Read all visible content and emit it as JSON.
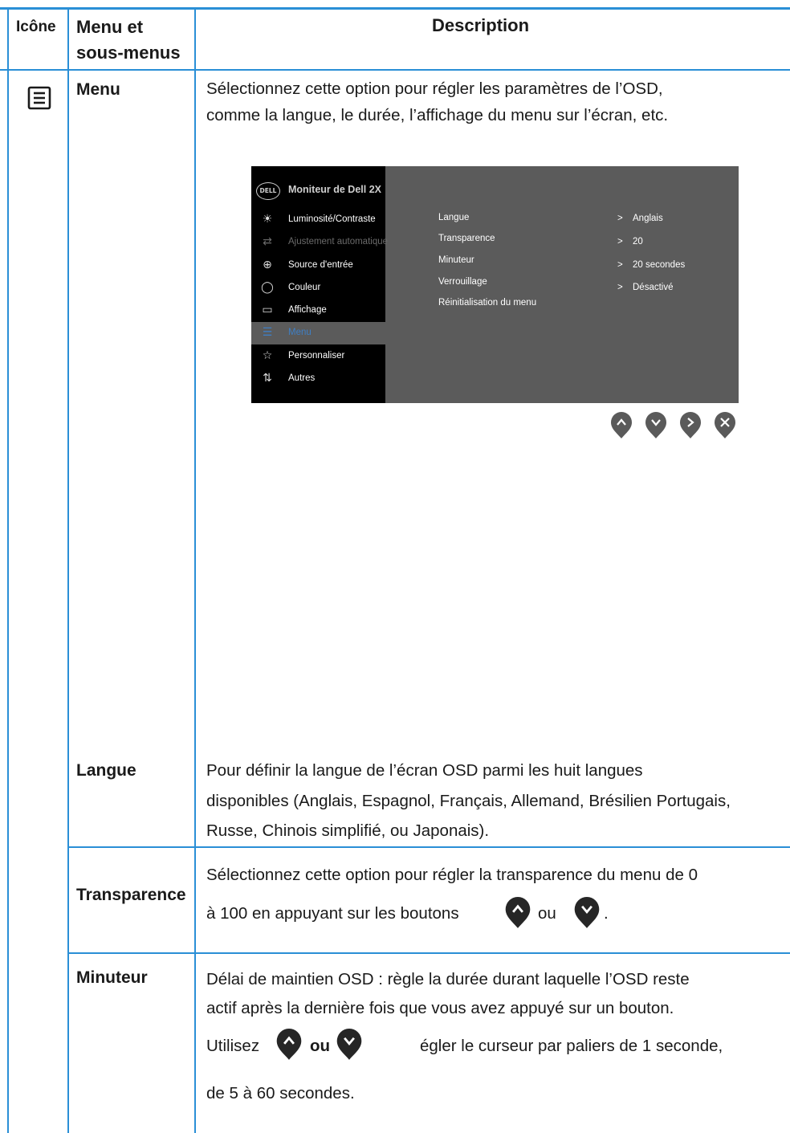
{
  "header": {
    "col_icon": "Icône",
    "col_menu_line1": "Menu et",
    "col_menu_line2": "sous-menus",
    "col_desc": "Description"
  },
  "rows": {
    "menu": {
      "icon": "menu-icon",
      "term": "Menu",
      "desc_line1": "Sélectionnez cette option pour régler les paramètres de l’OSD,",
      "desc_line2": "comme la langue, le durée, l’affichage du menu sur l’écran, etc."
    },
    "langue": {
      "term": "Langue",
      "desc_line1": "Pour définir la langue de l’écran OSD parmi les huit langues",
      "desc_line2": "disponibles (Anglais, Espagnol, Français, Allemand, Brésilien Portugais,",
      "desc_line3": "Russe, Chinois simplifié, ou Japonais)."
    },
    "transparence": {
      "term": "Transparence",
      "desc_line1": "Sélectionnez cette option pour régler la transparence du menu de 0",
      "desc_line2_a": "à 100 en appuyant sur les boutons",
      "desc_line2_b": "ou",
      "desc_line2_c": "."
    },
    "minuteur": {
      "term": "Minuteur",
      "desc_line1": "Délai de maintien OSD : règle la durée durant laquelle l’OSD reste",
      "desc_line2": "actif après la dernière fois que vous avez appuyé sur un bouton.",
      "desc_line3_a": "Utilisez",
      "desc_line3_b": "ou",
      "desc_line3_c": "égler le curseur par paliers de 1 seconde,",
      "desc_line4": "de 5 à 60 secondes."
    }
  },
  "osd": {
    "logo": "DELL",
    "title": "Moniteur de Dell 2X",
    "menu_items": [
      {
        "label": "Luminosité/Contraste",
        "icon": "brightness-icon",
        "state": "normal"
      },
      {
        "label": "Ajustement automatique",
        "icon": "auto-adjust-icon",
        "state": "disabled"
      },
      {
        "label": "Source d'entrée",
        "icon": "input-source-icon",
        "state": "normal"
      },
      {
        "label": "Couleur",
        "icon": "color-icon",
        "state": "normal"
      },
      {
        "label": "Affichage",
        "icon": "display-icon",
        "state": "normal"
      },
      {
        "label": "Menu",
        "icon": "menu-icon",
        "state": "selected"
      },
      {
        "label": "Personnaliser",
        "icon": "star-icon",
        "state": "normal"
      },
      {
        "label": "Autres",
        "icon": "others-icon",
        "state": "normal"
      }
    ],
    "settings": [
      {
        "label": "Langue",
        "arrow": ">",
        "value": "Anglais"
      },
      {
        "label": "Transparence",
        "arrow": ">",
        "value": "20"
      },
      {
        "label": "Minuteur",
        "arrow": ">",
        "value": "20 secondes"
      },
      {
        "label": "Verrouillage",
        "arrow": ">",
        "value": "Désactivé"
      },
      {
        "label": "Réinitialisation du menu"
      }
    ],
    "nav_buttons": [
      "up-button",
      "down-button",
      "right-button",
      "close-button"
    ]
  },
  "colors": {
    "rule": "#2a8fd6",
    "osd_panel": "#5b5b5b",
    "osd_sidebar": "#000000",
    "osd_selected_text": "#3f7fc4",
    "button_fill": "#5a5a5a"
  }
}
